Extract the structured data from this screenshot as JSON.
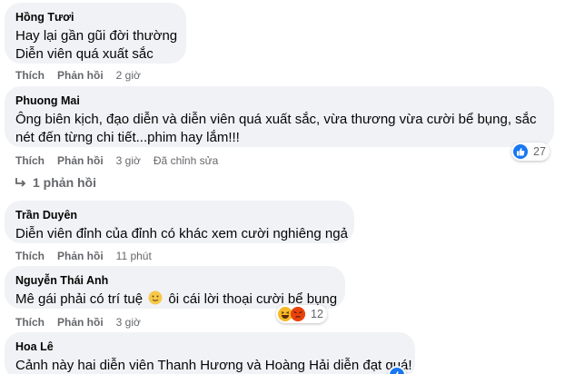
{
  "comments": [
    {
      "author": "Hồng Tươi",
      "lines": [
        "Hay lại gần gũi đời thường",
        "Diễn viên quá xuất sắc"
      ],
      "like": "Thích",
      "reply": "Phản hồi",
      "time": "2 giờ"
    },
    {
      "author": "Phuong Mai",
      "lines": [
        "Ông biên kịch, đạo diễn và diễn viên quá xuất sắc, vừa thương vừa cười bể bụng, sắc",
        "nét đến từng chi tiết...phim hay lắm!!!"
      ],
      "like": "Thích",
      "reply": "Phản hồi",
      "time": "3 giờ",
      "edited": "Đã chỉnh sửa",
      "reaction_count": "27"
    },
    {
      "author": "Trần Duyên",
      "lines": [
        "Diễn viên đỉnh của đỉnh có khác xem cười nghiêng ngả"
      ],
      "like": "Thích",
      "reply": "Phản hồi",
      "time": "11 phút"
    },
    {
      "author": "Nguyễn Thái Anh",
      "line_before_emoji": "Mê gái phải có trí tuệ",
      "line_after_emoji": "ôi cái lời thoại cười bể bụng",
      "like": "Thích",
      "reply": "Phản hồi",
      "time": "3 giờ",
      "reaction_count": "12"
    },
    {
      "author": "Hoa Lê",
      "lines": [
        "Cảnh này hai diễn viên Thanh Hương và Hoàng Hải diễn đạt quá!"
      ]
    }
  ],
  "view_replies": "1 phản hồi",
  "colors": {
    "bubble": "#f0f2f5",
    "like_blue": "#1877f2",
    "meta_gray": "#65676b"
  },
  "icons": {
    "like": "like-reaction-icon",
    "haha": "haha-reaction-icon",
    "angry": "angry-reaction-icon",
    "reply_arrow": "reply-arrow-icon"
  }
}
